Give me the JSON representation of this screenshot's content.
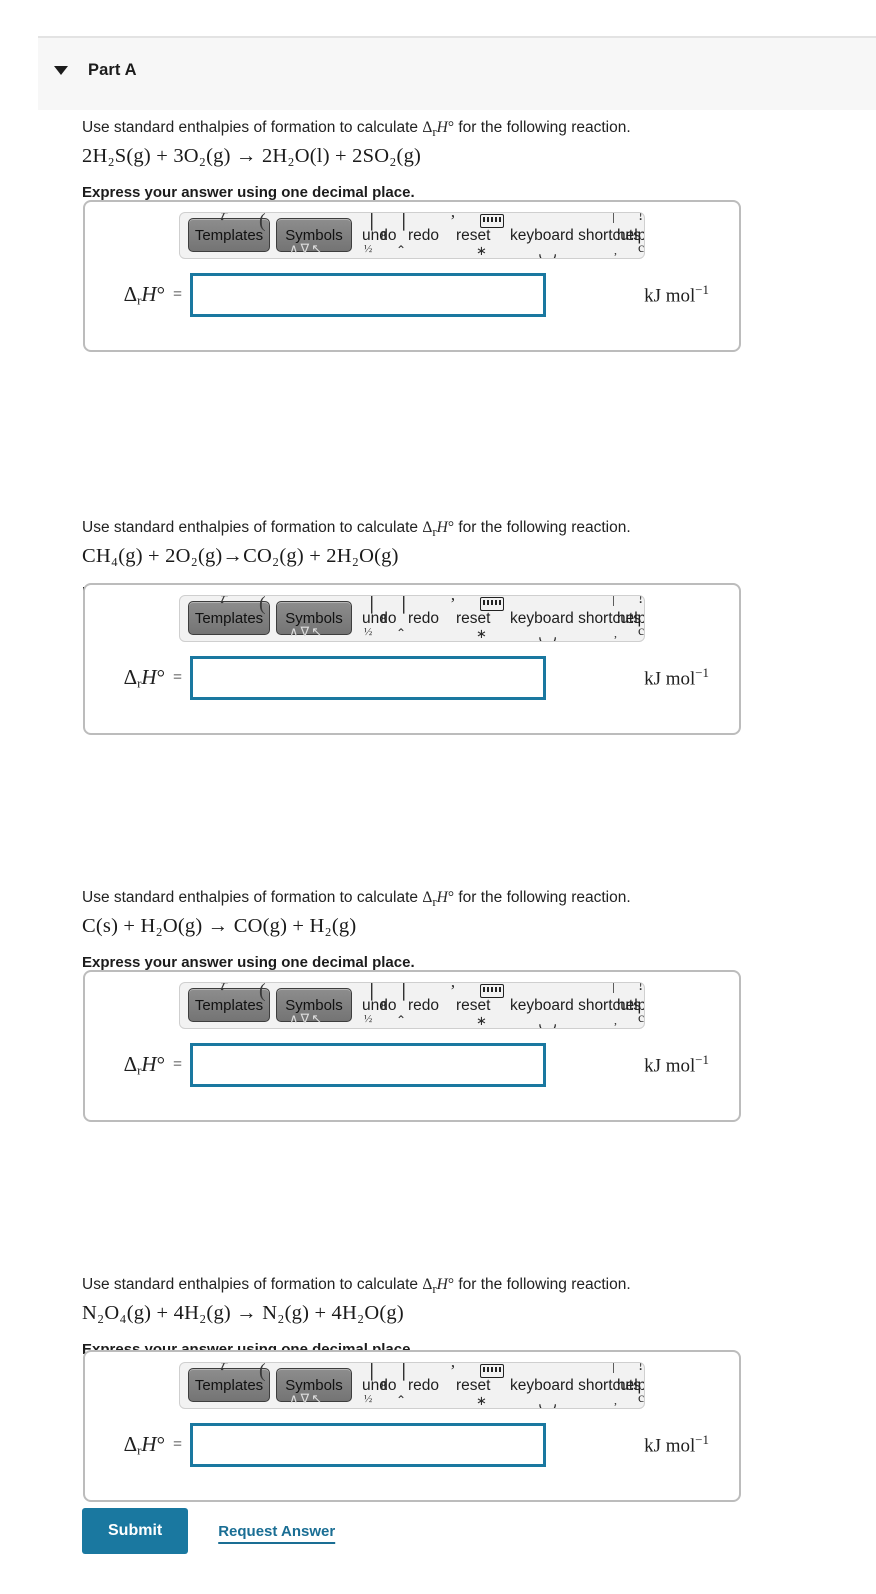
{
  "part": {
    "title": "Part A",
    "collapse_icon": "caret-down-icon"
  },
  "toolbar": {
    "templates_label": "Templates",
    "symbols_label": "Symbols",
    "undo_label": "undo",
    "redo_label": "redo",
    "reset_label": "reset",
    "keyboard_shortcuts_label": "keyboard shortcuts",
    "help_label": "help",
    "keyboard_icon": "keyboard-icon"
  },
  "answer": {
    "label_delta": "Δ",
    "label_sub": "r",
    "label_h": "H",
    "label_degree": "°",
    "equals": "=",
    "value": "",
    "placeholder": "",
    "units": "kJ mol",
    "units_exponent": "−1",
    "border_color": "#1a78a0"
  },
  "common": {
    "prompt_prefix": "Use standard enthalpies of formation to calculate ",
    "prompt_symbol": "Δ",
    "prompt_symbol_sub": "r",
    "prompt_symbol_h": "H",
    "prompt_symbol_deg": "°",
    "prompt_suffix": " for the following reaction.",
    "express_note": "Express your answer using one decimal place."
  },
  "questions": [
    {
      "id": "q1",
      "reaction": "2H₂S(g) + 3O₂(g) → 2H₂O(l) + 2SO₂(g)",
      "reaction_plain": "2H2S(g) + 3O2(g) -> 2H2O(l) + 2SO2(g)"
    },
    {
      "id": "q2",
      "reaction": "CH₄(g) + 2O₂(g)→CO₂(g) + 2H₂O(g)",
      "reaction_plain": "CH4(g) + 2O2(g)->CO2(g) + 2H2O(g)"
    },
    {
      "id": "q3",
      "reaction": "C(s) + H₂O(g) → CO(g) + H₂(g)",
      "reaction_plain": "C(s) + H2O(g) -> CO(g) + H2(g)"
    },
    {
      "id": "q4",
      "reaction": "N₂O₄(g) + 4H₂(g) → N₂(g) + 4H₂O(g)",
      "reaction_plain": "N2O4(g) + 4H2(g) -> N2(g) + 4H2O(g)"
    }
  ],
  "footer": {
    "submit_label": "Submit",
    "request_answer_label": "Request Answer",
    "accent_color": "#1a78a0"
  }
}
